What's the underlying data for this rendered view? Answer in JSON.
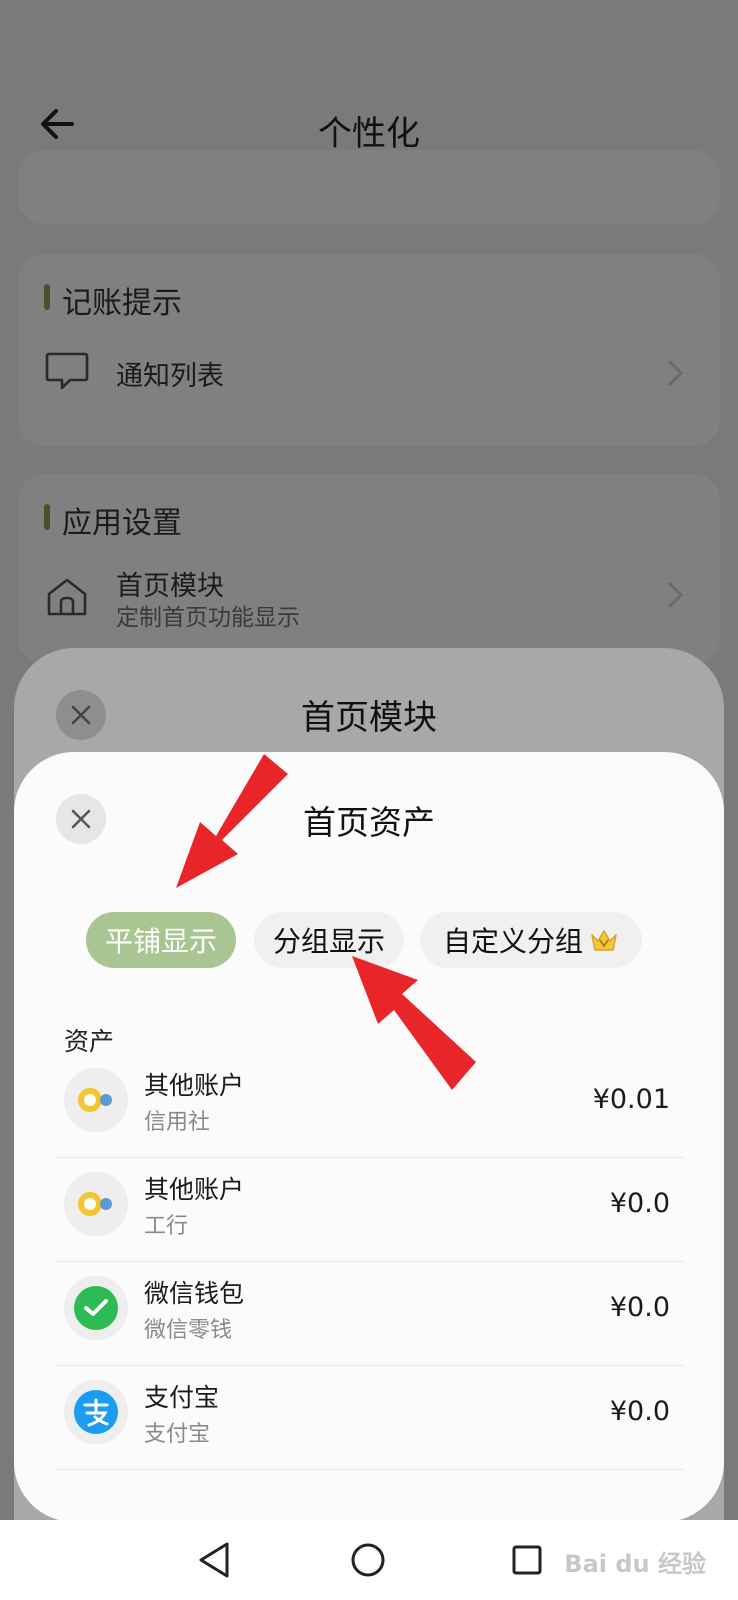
{
  "header": {
    "title": "个性化"
  },
  "notice_section": {
    "title": "记账提示",
    "items": [
      {
        "label": "通知列表",
        "icon": "chat-bubble-icon"
      }
    ]
  },
  "app_section": {
    "title": "应用设置",
    "items": [
      {
        "label": "首页模块",
        "sub": "定制首页功能显示",
        "icon": "home-icon"
      }
    ]
  },
  "sheet1": {
    "title": "首页模块"
  },
  "sheet2": {
    "title": "首页资产",
    "segments": [
      {
        "label": "平铺显示",
        "selected": true
      },
      {
        "label": "分组显示",
        "selected": false
      },
      {
        "label": "自定义分组",
        "selected": false,
        "badge": "crown-vip-icon"
      }
    ],
    "assets_label": "资产",
    "assets": [
      {
        "name": "其他账户",
        "sub": "信用社",
        "amount": "¥0.01",
        "icon": "coin-icon"
      },
      {
        "name": "其他账户",
        "sub": "工行",
        "amount": "¥0.0",
        "icon": "coin-icon"
      },
      {
        "name": "微信钱包",
        "sub": "微信零钱",
        "amount": "¥0.0",
        "icon": "wechat-icon"
      },
      {
        "name": "支付宝",
        "sub": "支付宝",
        "amount": "¥0.0",
        "icon": "alipay-icon"
      }
    ]
  },
  "colors": {
    "selected_segment": "#a9c592",
    "annotation_arrow": "#e8262a"
  },
  "watermark": "Bai du 经验"
}
